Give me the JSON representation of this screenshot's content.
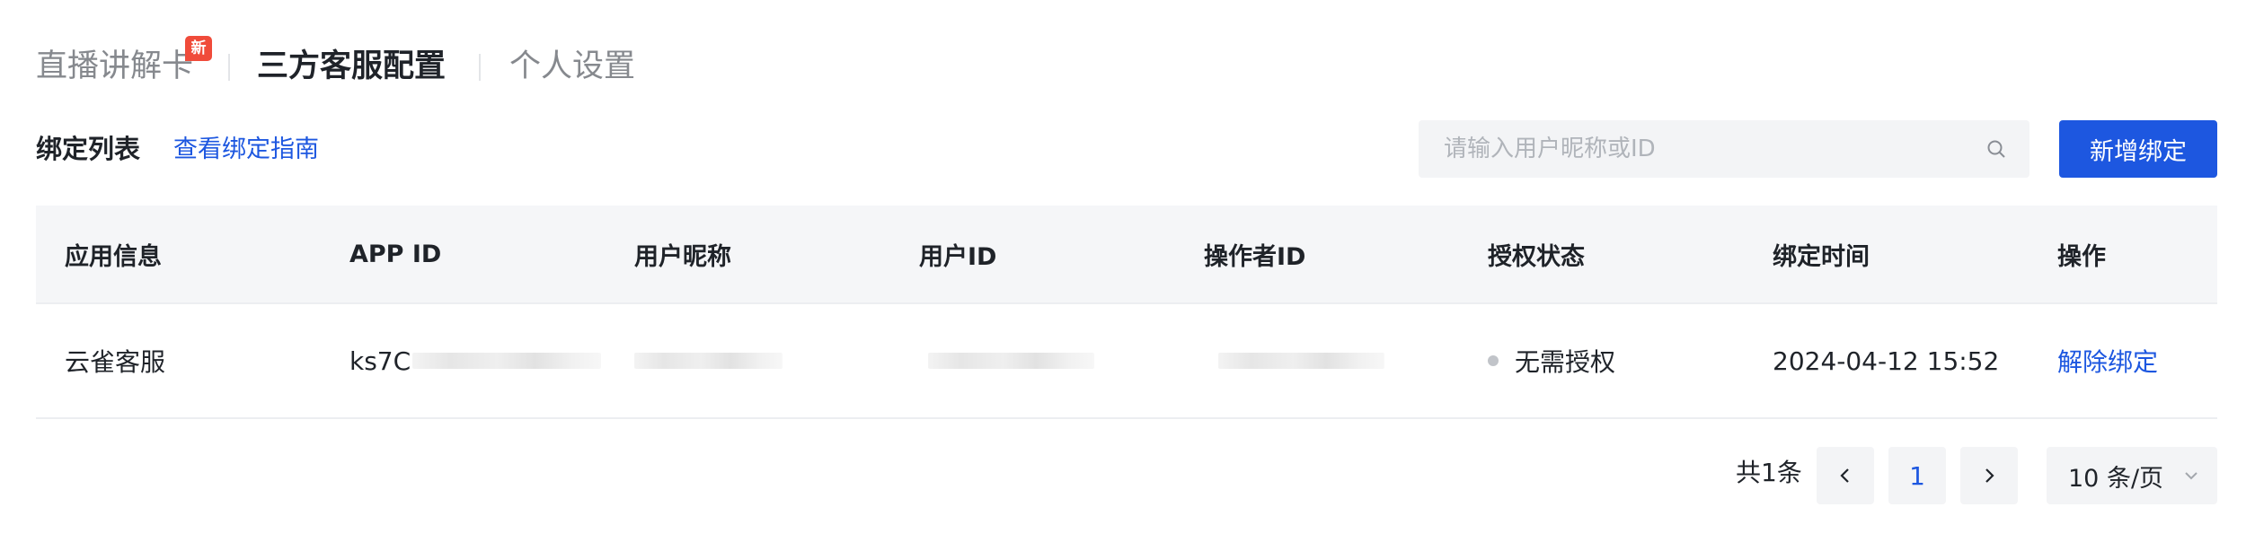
{
  "tabs": [
    {
      "label": "直播讲解卡",
      "badge": "新",
      "active": false
    },
    {
      "label": "三方客服配置",
      "active": true
    },
    {
      "label": "个人设置",
      "active": false
    }
  ],
  "toolbar": {
    "title": "绑定列表",
    "guide_link": "查看绑定指南",
    "search_placeholder": "请输入用户昵称或ID",
    "search_value": "",
    "add_button": "新增绑定"
  },
  "table": {
    "columns": [
      "应用信息",
      "APP ID",
      "用户昵称",
      "用户ID",
      "操作者ID",
      "授权状态",
      "绑定时间",
      "操作"
    ],
    "rows": [
      {
        "app_info": "云雀客服",
        "app_id_prefix": "ks7C",
        "status": "无需授权",
        "bind_time": "2024-04-12 15:52",
        "action": "解除绑定"
      }
    ]
  },
  "pagination": {
    "total": "共1条",
    "current_page": "1",
    "page_size": "10 条/页"
  },
  "icons": {
    "search": "search-icon",
    "prev": "chevron-left-icon",
    "next": "chevron-right-icon",
    "size_dropdown": "chevron-down-icon"
  },
  "colors": {
    "accent": "#1d57e0",
    "badge": "#f04b3a",
    "text": "#1f2329",
    "muted": "#86898e"
  }
}
